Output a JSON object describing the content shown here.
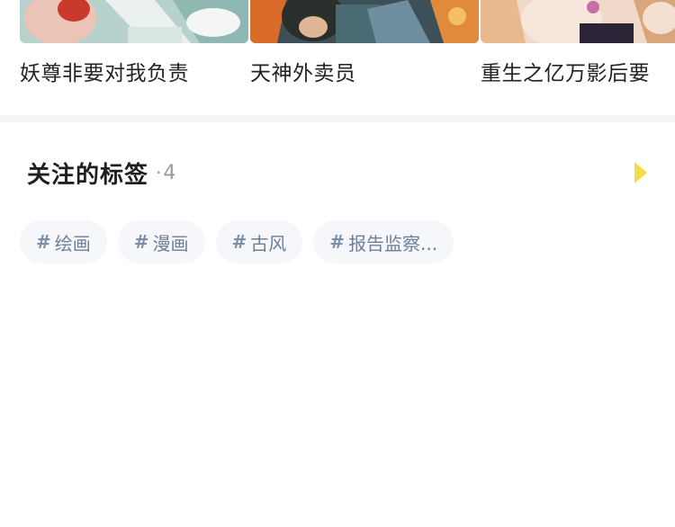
{
  "comics": [
    {
      "title": "妖尊非要对我负责"
    },
    {
      "title": "天神外卖员"
    },
    {
      "title": "重生之亿万影后要"
    }
  ],
  "tags_section": {
    "title": "关注的标签",
    "separator": "·",
    "count": "4",
    "tags": [
      {
        "hash": "#",
        "label": "绘画"
      },
      {
        "hash": "#",
        "label": "漫画"
      },
      {
        "hash": "#",
        "label": "古风"
      },
      {
        "hash": "#",
        "label": "报告监察..."
      }
    ]
  },
  "colors": {
    "arrow": "#f5dc4a",
    "tag_bg": "#f6f7fb",
    "tag_text": "#6f7f97",
    "divider": "#f4f5f9"
  },
  "icons": {
    "more_arrow": "triangle-right-icon"
  }
}
